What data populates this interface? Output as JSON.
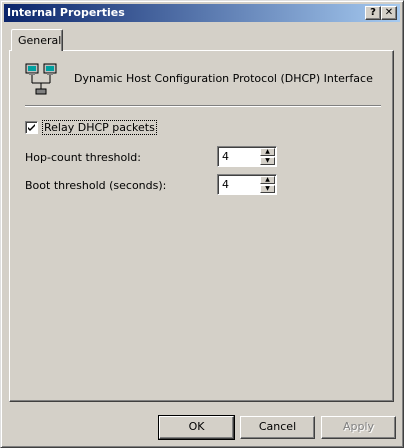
{
  "window": {
    "title": "Internal Properties"
  },
  "titlebar_buttons": {
    "help": "?",
    "close": "✕"
  },
  "tabs": [
    {
      "label": "General"
    }
  ],
  "general": {
    "interface_label": "Dynamic Host Configuration Protocol (DHCP) Interface",
    "relay_checkbox": {
      "label": "Relay DHCP packets",
      "checked": true
    },
    "hop_count": {
      "label": "Hop-count threshold:",
      "value": "4"
    },
    "boot_threshold": {
      "label": "Boot threshold (seconds):",
      "value": "4"
    }
  },
  "buttons": {
    "ok": "OK",
    "cancel": "Cancel",
    "apply": "Apply"
  },
  "icons": {
    "interface": "network-computers-icon"
  },
  "colors": {
    "titlebar_start": "#0a246a",
    "titlebar_end": "#a6caf0",
    "face": "#d4d0c8"
  }
}
